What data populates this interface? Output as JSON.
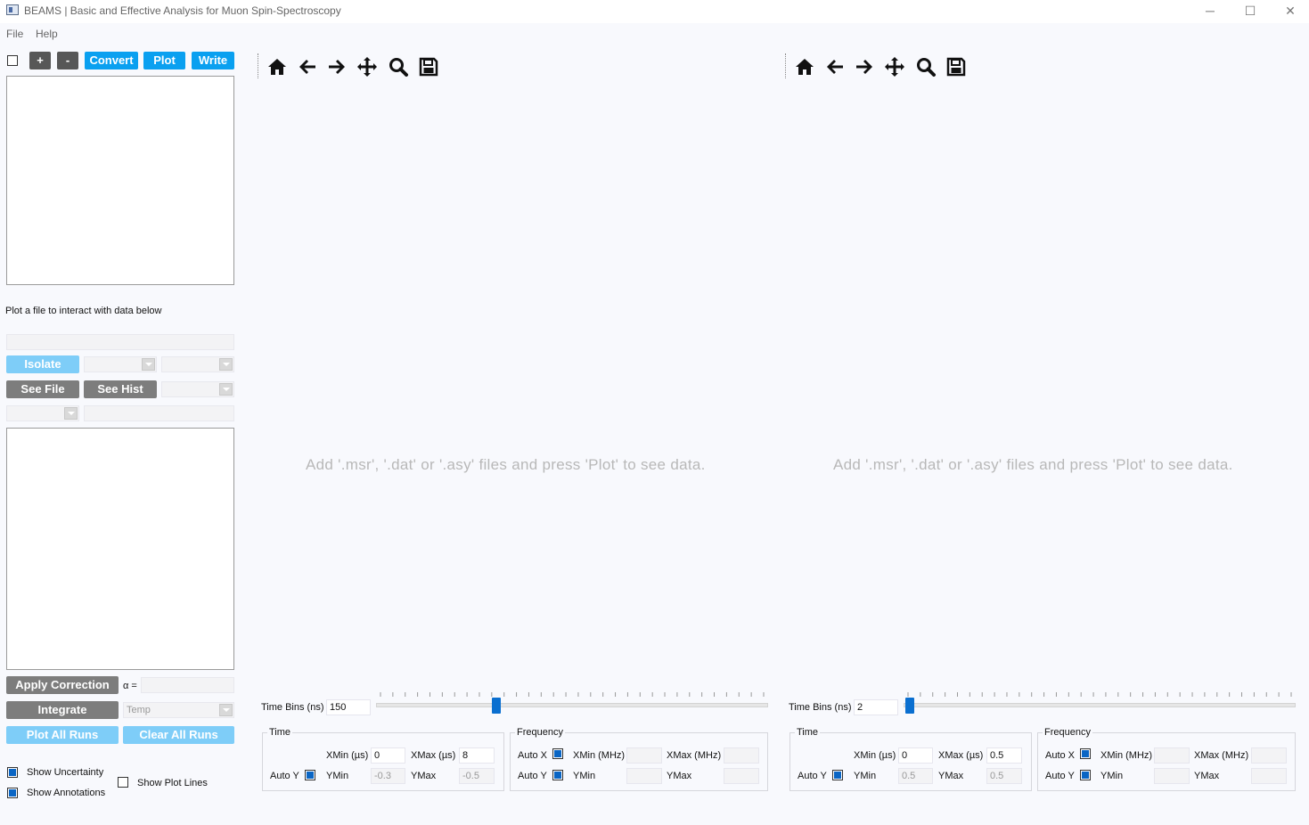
{
  "window": {
    "title": "BEAMS | Basic and Effective Analysis for Muon Spin-Spectroscopy",
    "minimize": "─",
    "maximize": "☐",
    "close": "✕"
  },
  "menu": [
    "File",
    "Help"
  ],
  "toolbar": {
    "add_label": "+",
    "remove_label": "-",
    "convert_label": "Convert",
    "plot_label": "Plot",
    "write_label": "Write"
  },
  "left": {
    "hint": "Plot a file to interact with data below",
    "isolate_label": "Isolate",
    "see_file_label": "See File",
    "see_hist_label": "See Hist",
    "apply_correction_label": "Apply Correction",
    "alpha_label": "α =",
    "integrate_label": "Integrate",
    "integrate_combo": "Temp",
    "plot_all_label": "Plot All Runs",
    "clear_all_label": "Clear All Runs",
    "show_uncertainty": "Show Uncertainty",
    "show_annotations": "Show Annotations",
    "show_plot_lines": "Show Plot Lines"
  },
  "plots": [
    {
      "placeholder": "Add '.msr', '.dat' or '.asy' files and press 'Plot' to see data.",
      "time_bins_label": "Time Bins (ns)",
      "time_bins": "150",
      "slider_level": 0.3,
      "time_title": "Time",
      "xmin_label": "XMin (µs)",
      "xmin": "0",
      "xmax_label": "XMax (µs)",
      "xmax": "8",
      "auto_y": "Auto Y",
      "ymin_label": "YMin",
      "ymin": "-0.3",
      "ymax_label": "YMax",
      "ymax": "-0.5",
      "freq_title": "Frequency",
      "auto_x": "Auto X",
      "fxmin_label": "XMin (MHz)",
      "fxmax_label": "XMax (MHz)",
      "fauto_y": "Auto Y",
      "fymin_label": "YMin",
      "fymax_label": "YMax"
    },
    {
      "placeholder": "Add '.msr', '.dat' or '.asy' files and press 'Plot' to see data.",
      "time_bins_label": "Time Bins (ns)",
      "time_bins": "2",
      "slider_level": 0.0,
      "time_title": "Time",
      "xmin_label": "XMin (µs)",
      "xmin": "0",
      "xmax_label": "XMax (µs)",
      "xmax": "0.5",
      "auto_y": "Auto Y",
      "ymin_label": "YMin",
      "ymin": "0.5",
      "ymax_label": "YMax",
      "ymax": "0.5",
      "freq_title": "Frequency",
      "auto_x": "Auto X",
      "fxmin_label": "XMin (MHz)",
      "fxmax_label": "XMax (MHz)",
      "fauto_y": "Auto Y",
      "fymin_label": "YMin",
      "fymax_label": "YMax"
    }
  ]
}
